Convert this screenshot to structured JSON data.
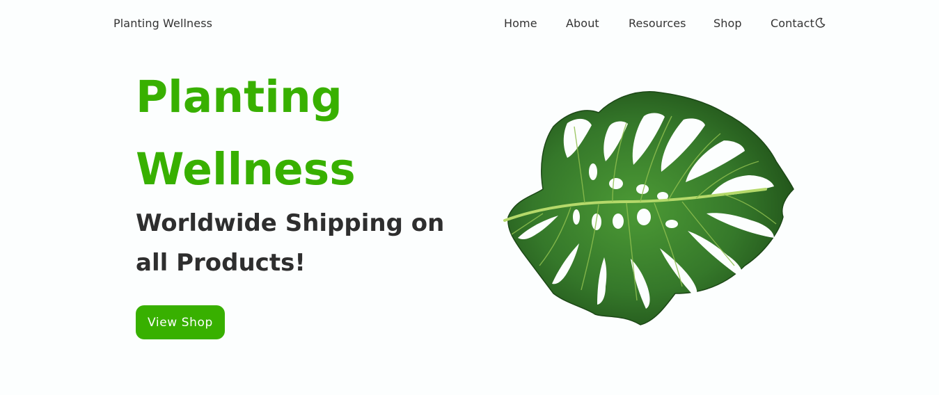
{
  "nav": {
    "brand": "Planting Wellness",
    "links": [
      "Home",
      "About",
      "Resources",
      "Shop",
      "Contact"
    ],
    "theme_icon": "moon-icon"
  },
  "hero": {
    "title_lines": [
      "Planting",
      "Wellness"
    ],
    "subtitle_lines": [
      "Worldwide Shipping on",
      "all Products!"
    ],
    "cta_label": "View Shop",
    "image": "monstera-leaf-image"
  },
  "colors": {
    "accent": "#38b000",
    "text": "#333333",
    "background": "#fcfefe",
    "leaf_dark": "#2e6b1f",
    "leaf_mid": "#3f8a2a",
    "leaf_vein": "#b5d96a"
  }
}
